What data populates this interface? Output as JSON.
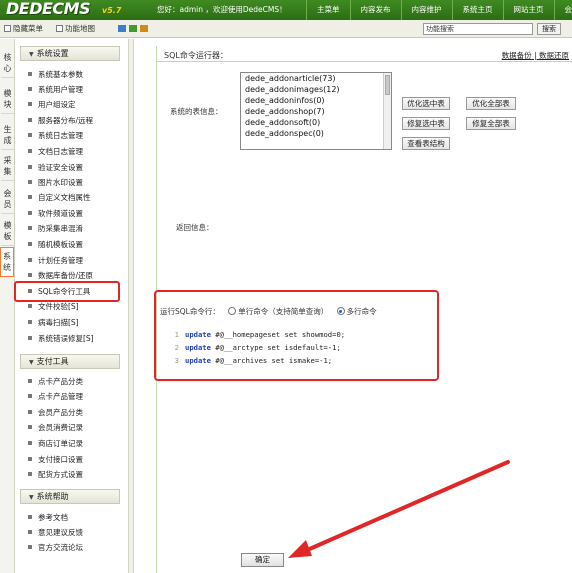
{
  "header": {
    "logo": "DEDECMS",
    "version": "v5.7",
    "welcome": "您好：admin ，欢迎使用DedeCMS！",
    "menu": [
      "主菜单",
      "内容发布",
      "内容维护",
      "系统主页",
      "网站主页",
      "会员"
    ]
  },
  "subbar": {
    "hide_menu": "隐藏菜单",
    "func_map": "功能地图",
    "search_placeholder": "功能搜索",
    "search_button": "搜索",
    "skin_colors": [
      "#3a7fc8",
      "#3e9d2d",
      "#d08a18"
    ]
  },
  "vtabs": [
    "核心",
    "模块",
    "生成",
    "采集",
    "会员",
    "模板",
    "系统"
  ],
  "sidebar": {
    "groups": [
      {
        "title": "系统设置",
        "items": [
          "系统基本参数",
          "系统用户管理",
          "用户组设定",
          "服务器分布/远程",
          "系统日志管理",
          "文档日志管理",
          "验证安全设置",
          "图片水印设置",
          "自定义文档属性",
          "软件频道设置",
          "防采集串混淆",
          "随机模板设置",
          "计划任务管理",
          "数据库备份/还原",
          "SQL命令行工具",
          "文件校验[S]",
          "病毒扫描[S]",
          "系统错误修复[S]"
        ]
      },
      {
        "title": "支付工具",
        "items": [
          "点卡产品分类",
          "点卡产品管理",
          "会员产品分类",
          "会员消费记录",
          "商店订单记录",
          "支付接口设置",
          "配货方式设置"
        ]
      },
      {
        "title": "系统帮助",
        "items": [
          "参考文档",
          "意见建议反馈",
          "官方交流论坛"
        ]
      }
    ]
  },
  "main": {
    "title": "SQL命令运行器：",
    "link_backup": "数据备份",
    "link_sep": "|",
    "link_restore": "数据还原",
    "tables_label": "系统的表信息：",
    "tables": [
      "dede_addonarticle(73)",
      "dede_addonimages(12)",
      "dede_addoninfos(0)",
      "dede_addonshop(7)",
      "dede_addonsoft(0)",
      "dede_addonspec(0)"
    ],
    "buttons": {
      "optimize_selected": "优化选中表",
      "optimize_all": "优化全部表",
      "repair_selected": "修复选中表",
      "repair_all": "修复全部表",
      "view_structure": "查看表结构"
    },
    "return_label": "返回信息：",
    "sql_label": "运行SQL命令行：",
    "radio_single": "单行命令（支持简单查询）",
    "radio_multi": "多行命令",
    "code": [
      {
        "num": "1",
        "kw": "update",
        "rest": " #@__homepageset set showmod=0;"
      },
      {
        "num": "2",
        "kw": "update",
        "rest": " #@__arctype set isdefault=-1;"
      },
      {
        "num": "3",
        "kw": "update",
        "rest": " #@__archives set ismake=-1;"
      }
    ],
    "ok_button": "确定"
  },
  "colors": {
    "header_green": "#2c6d14",
    "annotation_red": "#e02727"
  }
}
